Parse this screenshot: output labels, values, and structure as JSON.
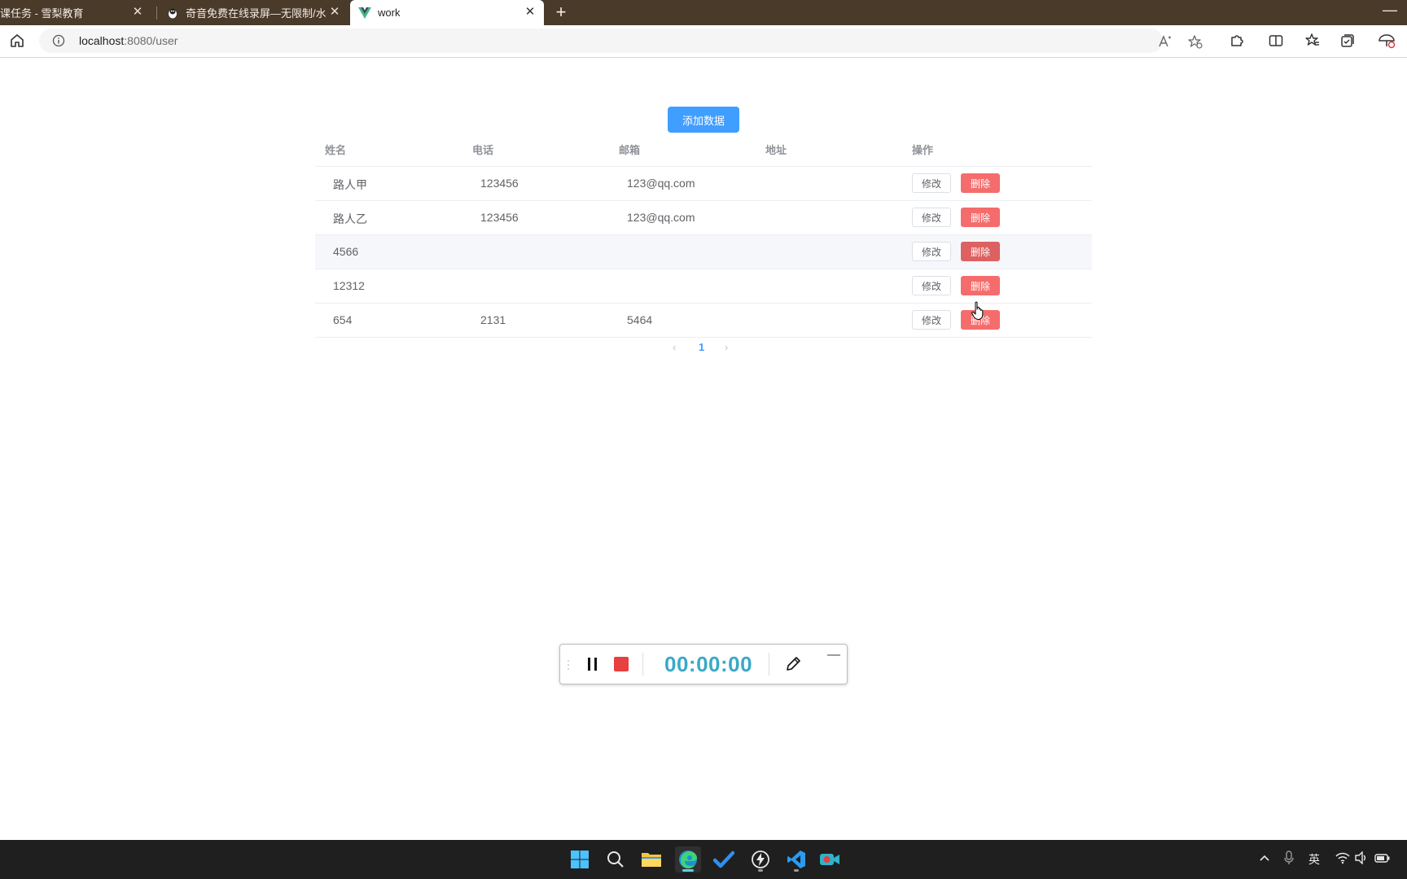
{
  "browser": {
    "tabs": [
      {
        "title": "步课任务 - 雪梨教育",
        "active": false
      },
      {
        "title": "奇音免费在线录屏—无限制/水印",
        "active": false
      },
      {
        "title": "work",
        "active": true
      }
    ],
    "new_tab": "+",
    "close_glyph": "✕",
    "minimize_glyph": "—",
    "url_host": "localhost",
    "url_rest": ":8080/user"
  },
  "page": {
    "add_button": "添加数据",
    "table": {
      "headers": [
        "姓名",
        "电话",
        "邮箱",
        "地址",
        "操作"
      ],
      "rows": [
        {
          "name": "路人甲",
          "phone": "123456",
          "email": "123@qq.com",
          "address": ""
        },
        {
          "name": "路人乙",
          "phone": "123456",
          "email": "123@qq.com",
          "address": ""
        },
        {
          "name": "4566",
          "phone": "",
          "email": "",
          "address": ""
        },
        {
          "name": "12312",
          "phone": "",
          "email": "",
          "address": ""
        },
        {
          "name": "654",
          "phone": "2131",
          "email": "5464",
          "address": ""
        }
      ],
      "edit_label": "修改",
      "delete_label": "删除"
    },
    "pagination": {
      "prev": "‹",
      "current": "1",
      "next": "›"
    }
  },
  "recorder": {
    "time": "00:00:00",
    "minimize": "—"
  },
  "taskbar": {
    "ime": "英"
  },
  "colors": {
    "primary": "#409eff",
    "danger": "#f56c6c",
    "tabbar": "#4a3a2a",
    "timer": "#3aa9c6",
    "stop": "#e64040"
  }
}
